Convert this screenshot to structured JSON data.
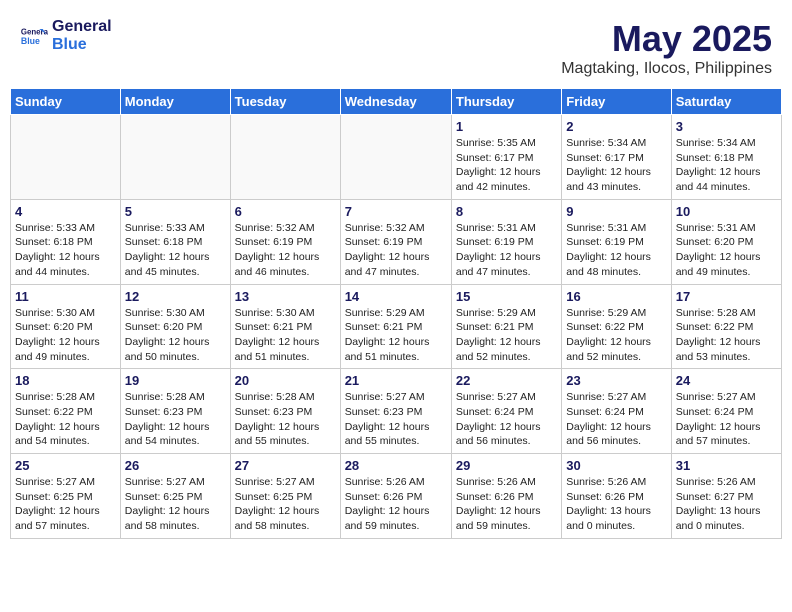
{
  "header": {
    "logo_line1": "General",
    "logo_line2": "Blue",
    "month_year": "May 2025",
    "location": "Magtaking, Ilocos, Philippines"
  },
  "weekdays": [
    "Sunday",
    "Monday",
    "Tuesday",
    "Wednesday",
    "Thursday",
    "Friday",
    "Saturday"
  ],
  "weeks": [
    [
      {
        "day": "",
        "info": ""
      },
      {
        "day": "",
        "info": ""
      },
      {
        "day": "",
        "info": ""
      },
      {
        "day": "",
        "info": ""
      },
      {
        "day": "1",
        "info": "Sunrise: 5:35 AM\nSunset: 6:17 PM\nDaylight: 12 hours\nand 42 minutes."
      },
      {
        "day": "2",
        "info": "Sunrise: 5:34 AM\nSunset: 6:17 PM\nDaylight: 12 hours\nand 43 minutes."
      },
      {
        "day": "3",
        "info": "Sunrise: 5:34 AM\nSunset: 6:18 PM\nDaylight: 12 hours\nand 44 minutes."
      }
    ],
    [
      {
        "day": "4",
        "info": "Sunrise: 5:33 AM\nSunset: 6:18 PM\nDaylight: 12 hours\nand 44 minutes."
      },
      {
        "day": "5",
        "info": "Sunrise: 5:33 AM\nSunset: 6:18 PM\nDaylight: 12 hours\nand 45 minutes."
      },
      {
        "day": "6",
        "info": "Sunrise: 5:32 AM\nSunset: 6:19 PM\nDaylight: 12 hours\nand 46 minutes."
      },
      {
        "day": "7",
        "info": "Sunrise: 5:32 AM\nSunset: 6:19 PM\nDaylight: 12 hours\nand 47 minutes."
      },
      {
        "day": "8",
        "info": "Sunrise: 5:31 AM\nSunset: 6:19 PM\nDaylight: 12 hours\nand 47 minutes."
      },
      {
        "day": "9",
        "info": "Sunrise: 5:31 AM\nSunset: 6:19 PM\nDaylight: 12 hours\nand 48 minutes."
      },
      {
        "day": "10",
        "info": "Sunrise: 5:31 AM\nSunset: 6:20 PM\nDaylight: 12 hours\nand 49 minutes."
      }
    ],
    [
      {
        "day": "11",
        "info": "Sunrise: 5:30 AM\nSunset: 6:20 PM\nDaylight: 12 hours\nand 49 minutes."
      },
      {
        "day": "12",
        "info": "Sunrise: 5:30 AM\nSunset: 6:20 PM\nDaylight: 12 hours\nand 50 minutes."
      },
      {
        "day": "13",
        "info": "Sunrise: 5:30 AM\nSunset: 6:21 PM\nDaylight: 12 hours\nand 51 minutes."
      },
      {
        "day": "14",
        "info": "Sunrise: 5:29 AM\nSunset: 6:21 PM\nDaylight: 12 hours\nand 51 minutes."
      },
      {
        "day": "15",
        "info": "Sunrise: 5:29 AM\nSunset: 6:21 PM\nDaylight: 12 hours\nand 52 minutes."
      },
      {
        "day": "16",
        "info": "Sunrise: 5:29 AM\nSunset: 6:22 PM\nDaylight: 12 hours\nand 52 minutes."
      },
      {
        "day": "17",
        "info": "Sunrise: 5:28 AM\nSunset: 6:22 PM\nDaylight: 12 hours\nand 53 minutes."
      }
    ],
    [
      {
        "day": "18",
        "info": "Sunrise: 5:28 AM\nSunset: 6:22 PM\nDaylight: 12 hours\nand 54 minutes."
      },
      {
        "day": "19",
        "info": "Sunrise: 5:28 AM\nSunset: 6:23 PM\nDaylight: 12 hours\nand 54 minutes."
      },
      {
        "day": "20",
        "info": "Sunrise: 5:28 AM\nSunset: 6:23 PM\nDaylight: 12 hours\nand 55 minutes."
      },
      {
        "day": "21",
        "info": "Sunrise: 5:27 AM\nSunset: 6:23 PM\nDaylight: 12 hours\nand 55 minutes."
      },
      {
        "day": "22",
        "info": "Sunrise: 5:27 AM\nSunset: 6:24 PM\nDaylight: 12 hours\nand 56 minutes."
      },
      {
        "day": "23",
        "info": "Sunrise: 5:27 AM\nSunset: 6:24 PM\nDaylight: 12 hours\nand 56 minutes."
      },
      {
        "day": "24",
        "info": "Sunrise: 5:27 AM\nSunset: 6:24 PM\nDaylight: 12 hours\nand 57 minutes."
      }
    ],
    [
      {
        "day": "25",
        "info": "Sunrise: 5:27 AM\nSunset: 6:25 PM\nDaylight: 12 hours\nand 57 minutes."
      },
      {
        "day": "26",
        "info": "Sunrise: 5:27 AM\nSunset: 6:25 PM\nDaylight: 12 hours\nand 58 minutes."
      },
      {
        "day": "27",
        "info": "Sunrise: 5:27 AM\nSunset: 6:25 PM\nDaylight: 12 hours\nand 58 minutes."
      },
      {
        "day": "28",
        "info": "Sunrise: 5:26 AM\nSunset: 6:26 PM\nDaylight: 12 hours\nand 59 minutes."
      },
      {
        "day": "29",
        "info": "Sunrise: 5:26 AM\nSunset: 6:26 PM\nDaylight: 12 hours\nand 59 minutes."
      },
      {
        "day": "30",
        "info": "Sunrise: 5:26 AM\nSunset: 6:26 PM\nDaylight: 13 hours\nand 0 minutes."
      },
      {
        "day": "31",
        "info": "Sunrise: 5:26 AM\nSunset: 6:27 PM\nDaylight: 13 hours\nand 0 minutes."
      }
    ]
  ]
}
